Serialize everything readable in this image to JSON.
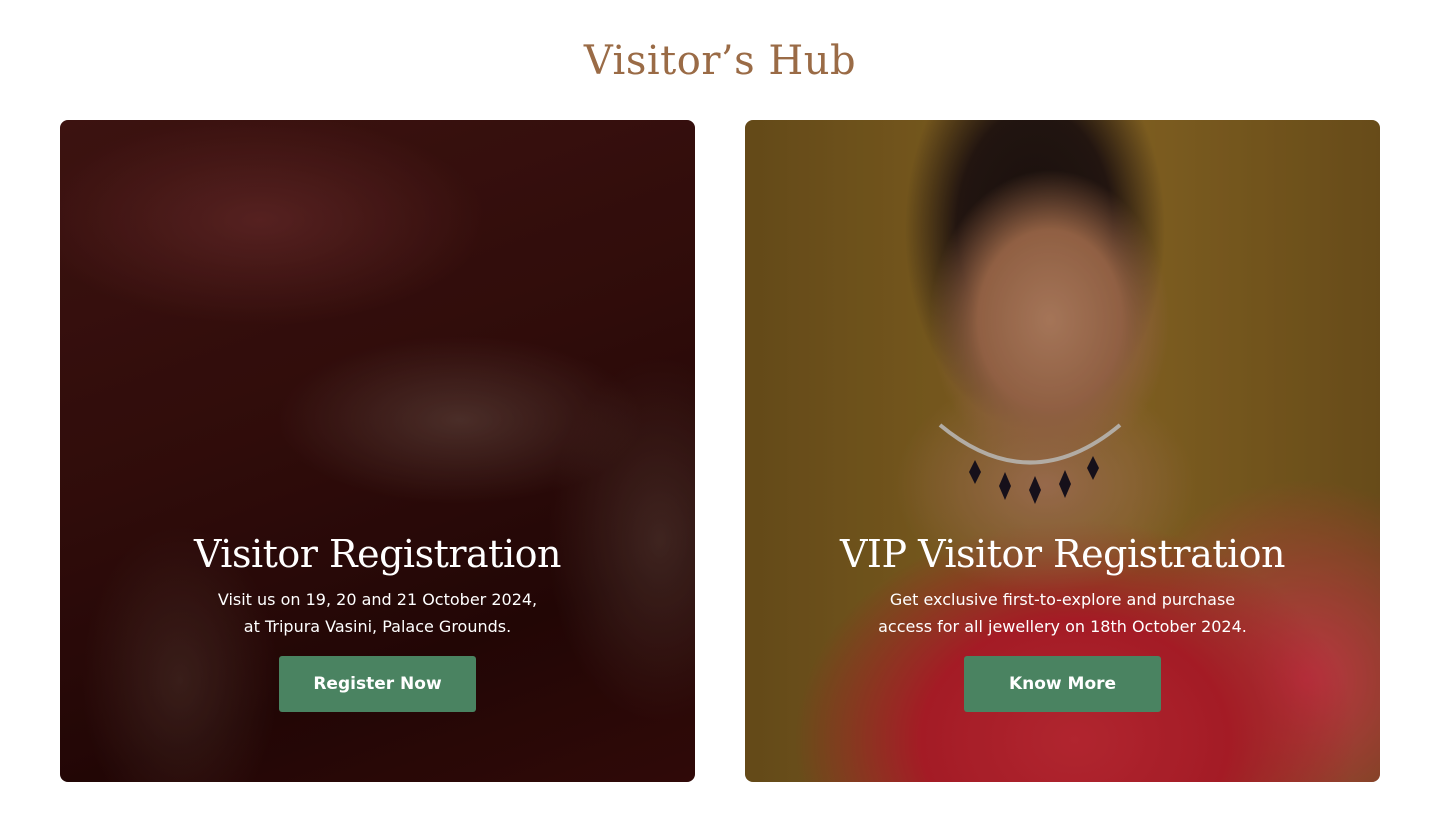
{
  "section": {
    "title": "Visitor’s Hub",
    "title_color": "#9a6b46"
  },
  "cards": [
    {
      "heading": "Visitor Registration",
      "description_lines": [
        "Visit us on 19, 20 and 21 October 2024,",
        "at Tripura Vasini, Palace Grounds."
      ],
      "button_label": "Register Now",
      "image": "jewellery-necklace-closeup-image"
    },
    {
      "heading": "VIP Visitor Registration",
      "description_lines": [
        "Get exclusive first-to-explore and purchase",
        "access for all jewellery on 18th October 2024."
      ],
      "button_label": "Know More",
      "image": "model-wearing-necklace-image"
    }
  ],
  "colors": {
    "button_bg": "#4a8361",
    "card_text": "#ffffff"
  }
}
